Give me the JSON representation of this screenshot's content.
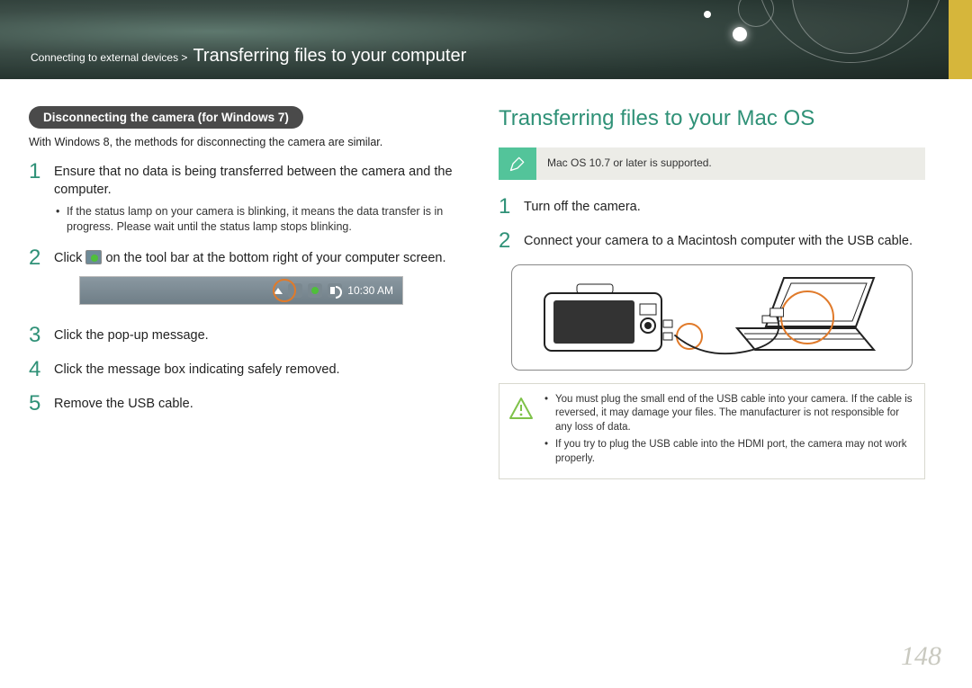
{
  "breadcrumb": {
    "parent": "Connecting to external devices >",
    "title": "Transferring files to your computer"
  },
  "left": {
    "pill": "Disconnecting the camera (for Windows 7)",
    "intro": "With Windows 8, the methods for disconnecting the camera are similar.",
    "step1": "Ensure that no data is being transferred between the camera and the computer.",
    "step1_bullet": "If the status lamp on your camera is blinking, it means the data transfer is in progress. Please wait until the status lamp stops blinking.",
    "step2_a": "Click",
    "step2_b": "on the tool bar at the bottom right of your computer screen.",
    "taskbar_time": "10:30 AM",
    "step3": "Click the pop-up message.",
    "step4": "Click the message box indicating safely removed.",
    "step5": "Remove the USB cable."
  },
  "right": {
    "heading": "Transferring files to your Mac OS",
    "note": "Mac OS 10.7 or later is supported.",
    "step1": "Turn off the camera.",
    "step2": "Connect your camera to a Macintosh computer with the USB cable.",
    "warn1": "You must plug the small end of the USB cable into your camera. If the cable is reversed, it may damage your files. The manufacturer is not responsible for any loss of data.",
    "warn2": "If you try to plug the USB cable into the HDMI port, the camera may not work properly."
  },
  "page_number": "148"
}
